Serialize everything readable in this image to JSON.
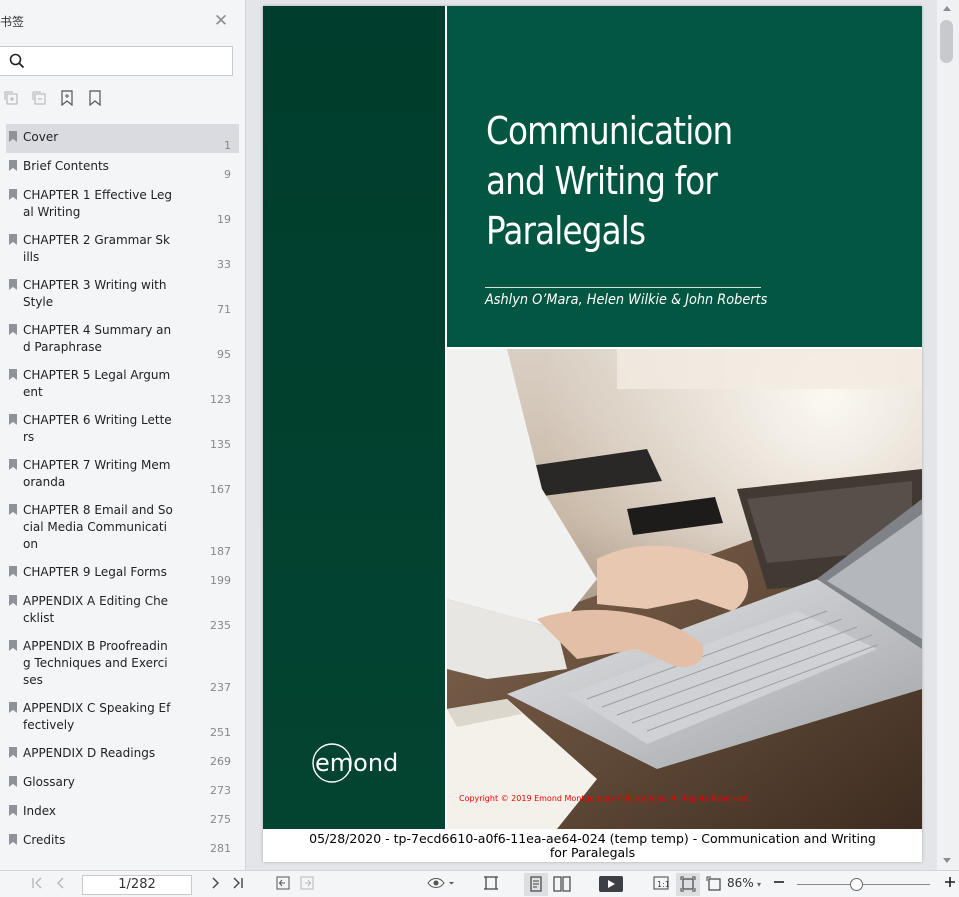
{
  "sidebar": {
    "title": "书签",
    "search": {
      "placeholder": "",
      "value": ""
    },
    "bookmarks": [
      {
        "label": "Cover",
        "page": "1",
        "selected": true
      },
      {
        "label": "Brief Contents",
        "page": "9"
      },
      {
        "label": "CHAPTER 1 Effective Legal Writing",
        "page": "19"
      },
      {
        "label": "CHAPTER 2 Grammar Skills",
        "page": "33"
      },
      {
        "label": "CHAPTER 3 Writing with Style",
        "page": "71"
      },
      {
        "label": "CHAPTER 4 Summary and Paraphrase",
        "page": "95"
      },
      {
        "label": "CHAPTER 5 Legal Argument",
        "page": "123"
      },
      {
        "label": "CHAPTER 6 Writing Letters",
        "page": "135"
      },
      {
        "label": "CHAPTER 7 Writing Memoranda",
        "page": "167"
      },
      {
        "label": "CHAPTER 8 Email and Social Media Communication",
        "page": "187"
      },
      {
        "label": "CHAPTER 9 Legal Forms",
        "page": "199"
      },
      {
        "label": "APPENDIX A Editing Checklist",
        "page": "235"
      },
      {
        "label": "APPENDIX B Proofreading Techniques and Exercises",
        "page": "237"
      },
      {
        "label": "APPENDIX C Speaking Effectively",
        "page": "251"
      },
      {
        "label": "APPENDIX D Readings",
        "page": "269"
      },
      {
        "label": "Glossary",
        "page": "273"
      },
      {
        "label": "Index",
        "page": "275"
      },
      {
        "label": "Credits",
        "page": "281"
      }
    ]
  },
  "cover": {
    "title_lines": [
      "Communication",
      "and Writing for",
      "Paralegals"
    ],
    "authors": "Ashlyn O’Mara, Helen Wilkie & John Roberts",
    "publisher_logo": "emond",
    "copyright": "Copyright © 2019 Emond Montgomery Publications. All Rights Reserved.",
    "footer": "05/28/2020 - tp-7ecd6610-a0f6-11ea-ae64-024 (temp temp) - Communication and Writing for Paralegals"
  },
  "toolbar": {
    "page_indicator": "1/282",
    "zoom": "86%",
    "zoom_slider_fraction": 0.44
  }
}
